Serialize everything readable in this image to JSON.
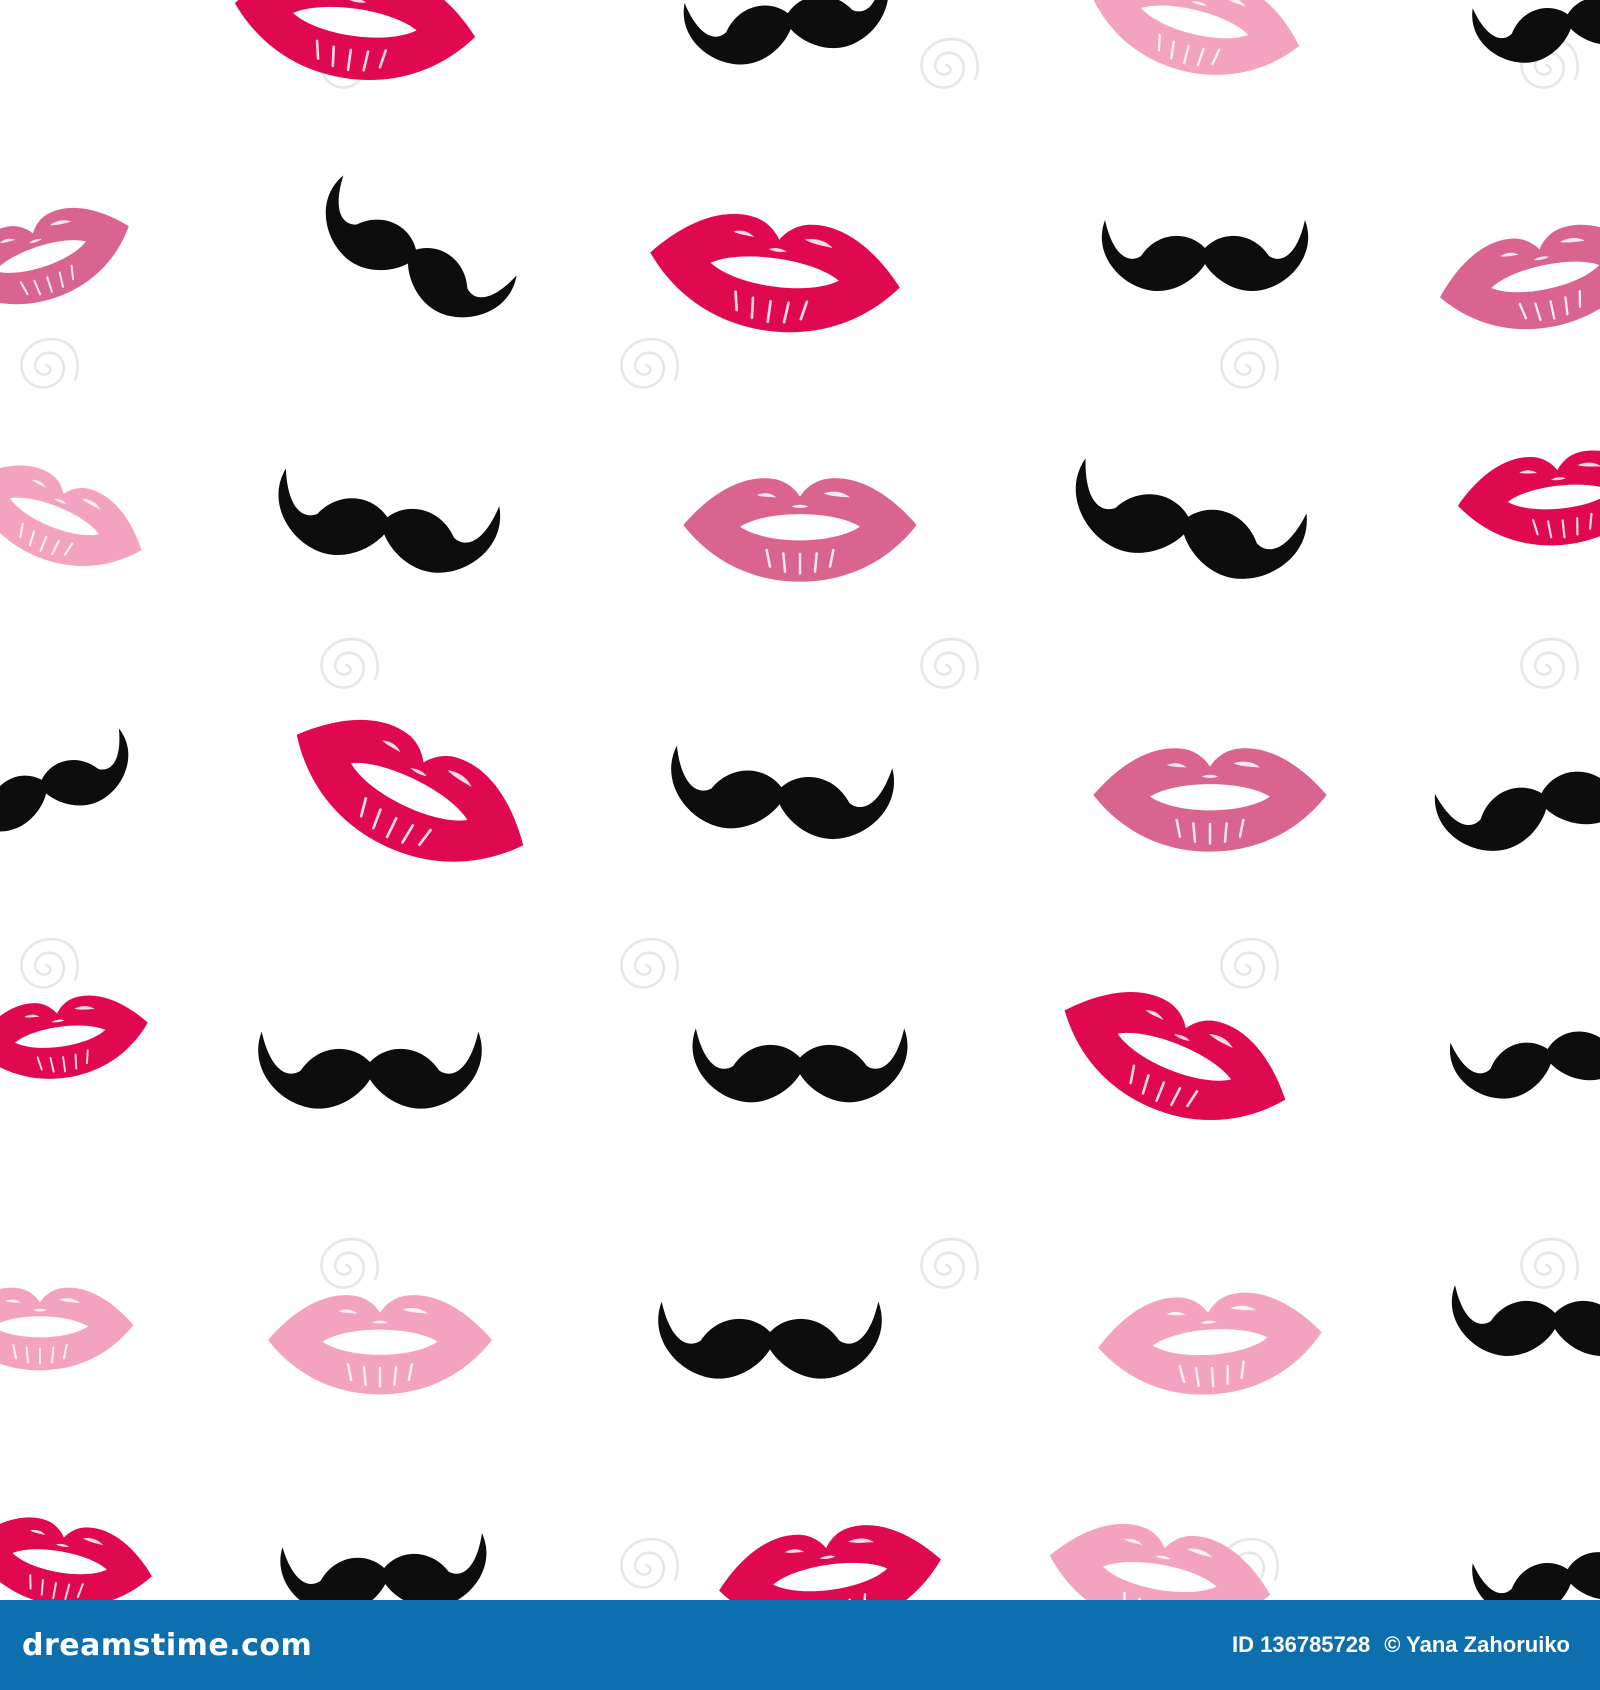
{
  "colors": {
    "background": "#ffffff",
    "mustache": "#0d0d0d",
    "lips_red": "#e0094f",
    "lips_rose": "#d9648f",
    "lips_pink": "#f3a3bf",
    "footer_bg": "#0d6fae",
    "watermark": "#d8d8d8"
  },
  "pattern": {
    "items": [
      {
        "kind": "lips",
        "tone": "lips_red"
      },
      {
        "kind": "mustache",
        "tone": "mustache"
      },
      {
        "kind": "lips",
        "tone": "lips_pink"
      },
      {
        "kind": "mustache",
        "tone": "mustache"
      },
      {
        "kind": "lips",
        "tone": "lips_rose"
      },
      {
        "kind": "mustache",
        "tone": "mustache"
      },
      {
        "kind": "lips",
        "tone": "lips_red"
      },
      {
        "kind": "mustache",
        "tone": "mustache"
      },
      {
        "kind": "lips",
        "tone": "lips_rose"
      },
      {
        "kind": "lips",
        "tone": "lips_pink"
      },
      {
        "kind": "mustache",
        "tone": "mustache"
      },
      {
        "kind": "lips",
        "tone": "lips_rose"
      },
      {
        "kind": "mustache",
        "tone": "mustache"
      },
      {
        "kind": "lips",
        "tone": "lips_red"
      },
      {
        "kind": "mustache",
        "tone": "mustache"
      },
      {
        "kind": "lips",
        "tone": "lips_red"
      },
      {
        "kind": "mustache",
        "tone": "mustache"
      },
      {
        "kind": "lips",
        "tone": "lips_rose"
      },
      {
        "kind": "mustache",
        "tone": "mustache"
      },
      {
        "kind": "lips",
        "tone": "lips_red"
      },
      {
        "kind": "mustache",
        "tone": "mustache"
      },
      {
        "kind": "mustache",
        "tone": "mustache"
      },
      {
        "kind": "lips",
        "tone": "lips_red"
      },
      {
        "kind": "mustache",
        "tone": "mustache"
      },
      {
        "kind": "lips",
        "tone": "lips_pink"
      },
      {
        "kind": "lips",
        "tone": "lips_pink"
      },
      {
        "kind": "mustache",
        "tone": "mustache"
      },
      {
        "kind": "lips",
        "tone": "lips_pink"
      },
      {
        "kind": "mustache",
        "tone": "mustache"
      },
      {
        "kind": "lips",
        "tone": "lips_red"
      },
      {
        "kind": "mustache",
        "tone": "mustache"
      },
      {
        "kind": "lips",
        "tone": "lips_red"
      },
      {
        "kind": "lips",
        "tone": "lips_pink"
      },
      {
        "kind": "mustache",
        "tone": "mustache"
      }
    ]
  },
  "footer": {
    "logo_text": "dreamstime.com",
    "id_label": "ID 136785728",
    "copyright": "© Yana Zahoruiko"
  }
}
